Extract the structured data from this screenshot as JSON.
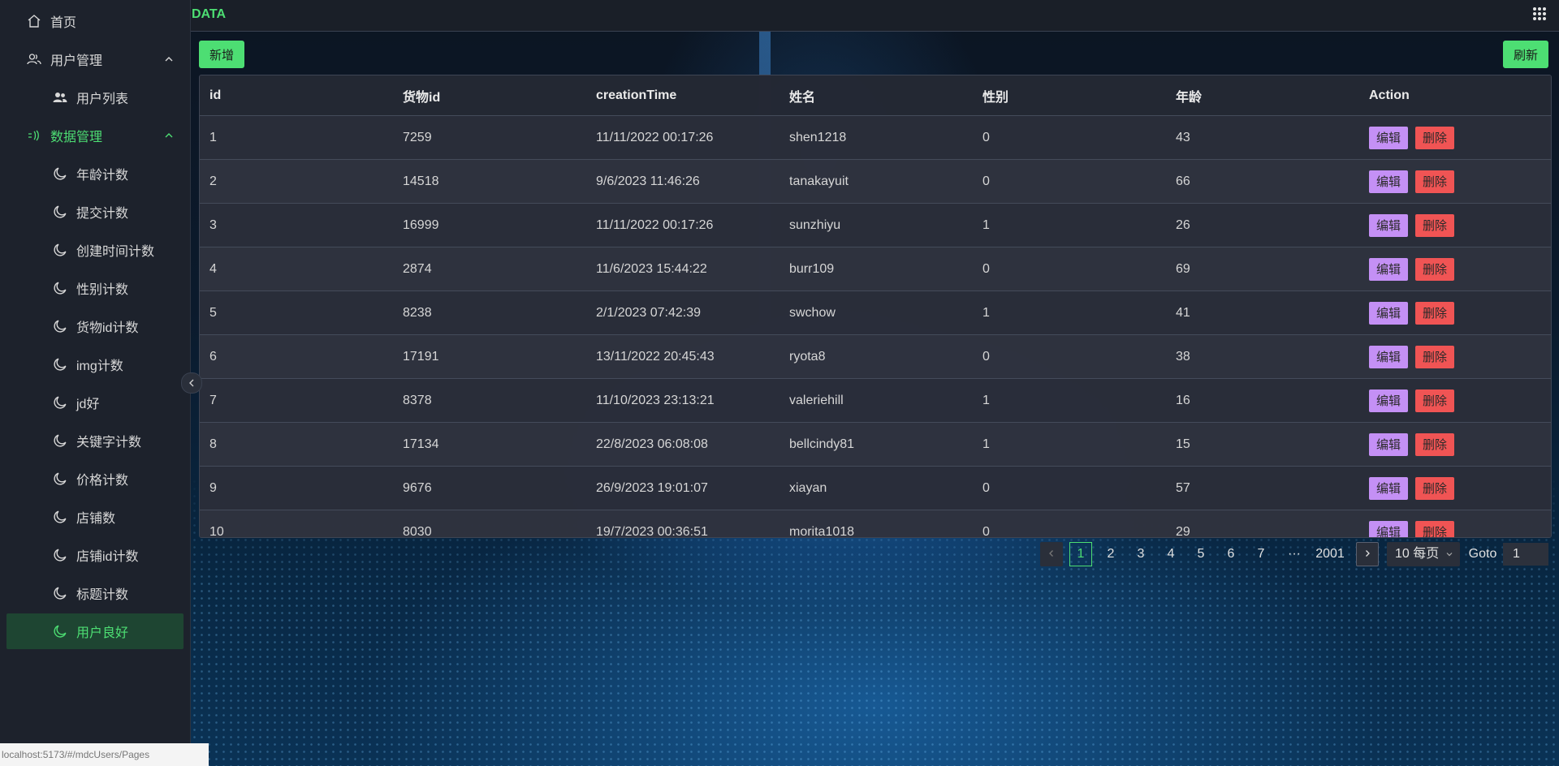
{
  "header": {
    "brand": "DATA",
    "apps_icon": "grid-icon"
  },
  "sidebar": {
    "home": {
      "label": "首页",
      "icon": "home-icon"
    },
    "user_mgmt": {
      "label": "用户管理",
      "icon": "users-icon",
      "expanded": true
    },
    "user_list": {
      "label": "用户列表",
      "icon": "people-icon"
    },
    "data_mgmt": {
      "label": "数据管理",
      "icon": "data-icon",
      "expanded": true
    },
    "items": [
      {
        "label": "年龄计数",
        "icon": "moon-icon"
      },
      {
        "label": "提交计数",
        "icon": "moon-icon"
      },
      {
        "label": "创建时间计数",
        "icon": "moon-icon"
      },
      {
        "label": "性别计数",
        "icon": "moon-icon"
      },
      {
        "label": "货物id计数",
        "icon": "moon-icon"
      },
      {
        "label": "img计数",
        "icon": "moon-icon"
      },
      {
        "label": "jd好",
        "icon": "moon-icon"
      },
      {
        "label": "关键字计数",
        "icon": "moon-icon"
      },
      {
        "label": "价格计数",
        "icon": "moon-icon"
      },
      {
        "label": "店铺数",
        "icon": "moon-icon"
      },
      {
        "label": "店铺id计数",
        "icon": "moon-icon"
      },
      {
        "label": "标题计数",
        "icon": "moon-icon"
      },
      {
        "label": "用户良好",
        "icon": "moon-icon",
        "active": true
      }
    ]
  },
  "toolbar": {
    "add_label": "新增",
    "refresh_label": "刷新"
  },
  "table": {
    "columns": [
      "id",
      "货物id",
      "creationTime",
      "姓名",
      "性别",
      "年龄",
      "Action"
    ],
    "edit_label": "编辑",
    "delete_label": "删除",
    "rows": [
      [
        "1",
        "7259",
        "11/11/2022 00:17:26",
        "shen1218",
        "0",
        "43"
      ],
      [
        "2",
        "14518",
        "9/6/2023 11:46:26",
        "tanakayuit",
        "0",
        "66"
      ],
      [
        "3",
        "16999",
        "11/11/2022 00:17:26",
        "sunzhiyu",
        "1",
        "26"
      ],
      [
        "4",
        "2874",
        "11/6/2023 15:44:22",
        "burr109",
        "0",
        "69"
      ],
      [
        "5",
        "8238",
        "2/1/2023 07:42:39",
        "swchow",
        "1",
        "41"
      ],
      [
        "6",
        "17191",
        "13/11/2022 20:45:43",
        "ryota8",
        "0",
        "38"
      ],
      [
        "7",
        "8378",
        "11/10/2023 23:13:21",
        "valeriehill",
        "1",
        "16"
      ],
      [
        "8",
        "17134",
        "22/8/2023 06:08:08",
        "bellcindy81",
        "1",
        "15"
      ],
      [
        "9",
        "9676",
        "26/9/2023 19:01:07",
        "xiayan",
        "0",
        "57"
      ],
      [
        "10",
        "8030",
        "19/7/2023 00:36:51",
        "morita1018",
        "0",
        "29"
      ]
    ]
  },
  "pagination": {
    "pages": [
      "1",
      "2",
      "3",
      "4",
      "5",
      "6",
      "7"
    ],
    "current": "1",
    "ellipsis": "···",
    "last": "2001",
    "page_size": "10 每页",
    "goto_label": "Goto",
    "goto_value": "1"
  },
  "status_bar": {
    "text": "localhost:5173/#/mdcUsers/Pages"
  },
  "colors": {
    "accent": "#4dde73",
    "edit": "#c490f5",
    "delete": "#f05454"
  }
}
